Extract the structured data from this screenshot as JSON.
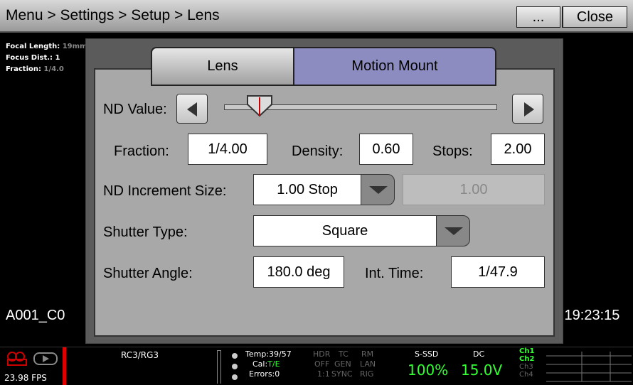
{
  "header": {
    "breadcrumb": "Menu > Settings > Setup > Lens",
    "more_label": "...",
    "close_label": "Close"
  },
  "lens_info": {
    "focal_length_label": "Focal Length:",
    "focal_length_value": "19mm",
    "focus_dist_label": "Focus Dist.:",
    "focus_dist_value": "1",
    "fraction_label": "Fraction:",
    "fraction_value": "1/4.0"
  },
  "clip_name": "A001_C0",
  "timecode": ":19:23:15",
  "tabs": [
    {
      "label": "Lens",
      "selected": false
    },
    {
      "label": "Motion Mount",
      "selected": true
    }
  ],
  "nd": {
    "label": "ND Value:",
    "slider_level": 0.13
  },
  "fraction": {
    "label": "Fraction:",
    "value": "1/4.00"
  },
  "density": {
    "label": "Density:",
    "value": "0.60"
  },
  "stops": {
    "label": "Stops:",
    "value": "2.00"
  },
  "nd_increment": {
    "label": "ND Increment Size:",
    "value": "1.00 Stop",
    "disabled_value": "1.00"
  },
  "shutter_type": {
    "label": "Shutter Type:",
    "value": "Square"
  },
  "shutter_angle": {
    "label": "Shutter Angle:",
    "value": "180.0 deg"
  },
  "int_time": {
    "label": "Int. Time:",
    "value": "1/47.9"
  },
  "status": {
    "fps": "23.98 FPS",
    "rc": "RC3/RG3",
    "temp": "Temp:39/57",
    "cal_label": "Cal:",
    "cal_value": "T/E",
    "errors": "Errors:0",
    "hdr": "HDR",
    "hdr_val": "OFF",
    "hdr_val2": "1:1",
    "tc": "TC",
    "tc_val": "GEN",
    "tc_val2": "SYNC",
    "rm": "RM",
    "rm_val": "LAN",
    "rm_val2": "RIG",
    "ssd_label": "S-SSD",
    "ssd_value": "100%",
    "dc_label": "DC",
    "dc_value": "15.0V",
    "ch1": "Ch1",
    "ch2": "Ch2",
    "ch3": "Ch3",
    "ch4": "Ch4"
  },
  "colors": {
    "selected_tab": "#8c8cc0",
    "accent_green": "#33ff33",
    "record_red": "#e00000"
  }
}
